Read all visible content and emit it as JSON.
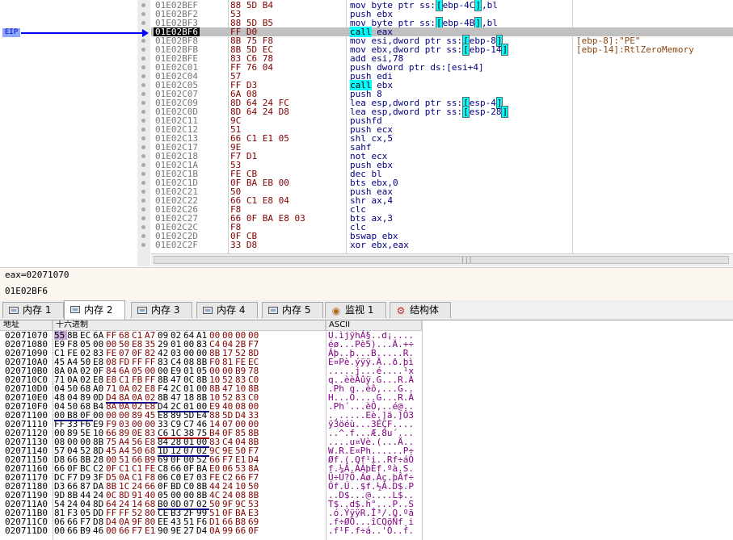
{
  "disassembly": {
    "eip_label": "EIP",
    "rows": [
      {
        "addr": "01E02BEF",
        "hex": "88 5D B4",
        "asm": [
          [
            "mov byte ptr ss:",
            ""
          ],
          [
            "[",
            "b"
          ],
          [
            "ebp-4C",
            ""
          ],
          [
            "]",
            "b"
          ],
          [
            ",bl",
            ""
          ]
        ],
        "cmt": ""
      },
      {
        "addr": "01E02BF2",
        "hex": "53",
        "asm": [
          [
            "push ebx",
            ""
          ]
        ],
        "cmt": ""
      },
      {
        "addr": "01E02BF3",
        "hex": "88 5D B5",
        "asm": [
          [
            "mov byte ptr ss:",
            ""
          ],
          [
            "[",
            "b"
          ],
          [
            "ebp-4B",
            ""
          ],
          [
            "]",
            "b"
          ],
          [
            ",bl",
            ""
          ]
        ],
        "cmt": ""
      },
      {
        "addr": "01E02BF6",
        "hex": "FF D0",
        "asm": [
          [
            "call",
            "h"
          ],
          [
            " eax",
            ""
          ]
        ],
        "cmt": "",
        "current": true
      },
      {
        "addr": "01E02BF8",
        "hex": "8B 75 F8",
        "asm": [
          [
            "mov esi,dword ptr ss:",
            ""
          ],
          [
            "[",
            "b"
          ],
          [
            "ebp-8",
            ""
          ],
          [
            "]",
            "b"
          ]
        ],
        "cmt": "[ebp-8]:\"PE\""
      },
      {
        "addr": "01E02BFB",
        "hex": "8B 5D EC",
        "asm": [
          [
            "mov ebx,dword ptr ss:",
            ""
          ],
          [
            "[",
            "b"
          ],
          [
            "ebp-14",
            ""
          ],
          [
            "]",
            "b"
          ]
        ],
        "cmt": "[ebp-14]:RtlZeroMemory"
      },
      {
        "addr": "01E02BFE",
        "hex": "83 C6 78",
        "asm": [
          [
            "add esi,78",
            ""
          ]
        ],
        "cmt": ""
      },
      {
        "addr": "01E02C01",
        "hex": "FF 76 04",
        "asm": [
          [
            "push dword ptr ds:[esi+4]",
            ""
          ]
        ],
        "cmt": ""
      },
      {
        "addr": "01E02C04",
        "hex": "57",
        "asm": [
          [
            "push edi",
            ""
          ]
        ],
        "cmt": ""
      },
      {
        "addr": "01E02C05",
        "hex": "FF D3",
        "asm": [
          [
            "call",
            "h"
          ],
          [
            " ebx",
            ""
          ]
        ],
        "cmt": ""
      },
      {
        "addr": "01E02C07",
        "hex": "6A 08",
        "asm": [
          [
            "push 8",
            ""
          ]
        ],
        "cmt": ""
      },
      {
        "addr": "01E02C09",
        "hex": "8D 64 24 FC",
        "asm": [
          [
            "lea esp,dword ptr ss:",
            ""
          ],
          [
            "[",
            "b"
          ],
          [
            "esp-4",
            ""
          ],
          [
            "]",
            "b"
          ]
        ],
        "cmt": ""
      },
      {
        "addr": "01E02C0D",
        "hex": "8D 64 24 D8",
        "asm": [
          [
            "lea esp,dword ptr ss:",
            ""
          ],
          [
            "[",
            "b"
          ],
          [
            "esp-28",
            ""
          ],
          [
            "]",
            "b"
          ]
        ],
        "cmt": ""
      },
      {
        "addr": "01E02C11",
        "hex": "9C",
        "asm": [
          [
            "pushfd",
            ""
          ]
        ],
        "cmt": ""
      },
      {
        "addr": "01E02C12",
        "hex": "51",
        "asm": [
          [
            "push ecx",
            ""
          ]
        ],
        "cmt": ""
      },
      {
        "addr": "01E02C13",
        "hex": "66 C1 E1 05",
        "asm": [
          [
            "shl cx,5",
            ""
          ]
        ],
        "cmt": ""
      },
      {
        "addr": "01E02C17",
        "hex": "9E",
        "asm": [
          [
            "sahf",
            ""
          ]
        ],
        "cmt": ""
      },
      {
        "addr": "01E02C18",
        "hex": "F7 D1",
        "asm": [
          [
            "not ecx",
            ""
          ]
        ],
        "cmt": ""
      },
      {
        "addr": "01E02C1A",
        "hex": "53",
        "asm": [
          [
            "push ebx",
            ""
          ]
        ],
        "cmt": ""
      },
      {
        "addr": "01E02C1B",
        "hex": "FE CB",
        "asm": [
          [
            "dec bl",
            ""
          ]
        ],
        "cmt": ""
      },
      {
        "addr": "01E02C1D",
        "hex": "0F BA EB 00",
        "asm": [
          [
            "bts ebx,0",
            ""
          ]
        ],
        "cmt": ""
      },
      {
        "addr": "01E02C21",
        "hex": "50",
        "asm": [
          [
            "push eax",
            ""
          ]
        ],
        "cmt": ""
      },
      {
        "addr": "01E02C22",
        "hex": "66 C1 E8 04",
        "asm": [
          [
            "shr ax,4",
            ""
          ]
        ],
        "cmt": ""
      },
      {
        "addr": "01E02C26",
        "hex": "F8",
        "asm": [
          [
            "clc",
            ""
          ]
        ],
        "cmt": ""
      },
      {
        "addr": "01E02C27",
        "hex": "66 0F BA E8 03",
        "asm": [
          [
            "bts ax,3",
            ""
          ]
        ],
        "cmt": ""
      },
      {
        "addr": "01E02C2C",
        "hex": "F8",
        "asm": [
          [
            "clc",
            ""
          ]
        ],
        "cmt": ""
      },
      {
        "addr": "01E02C2D",
        "hex": "0F CB",
        "asm": [
          [
            "bswap ebx",
            ""
          ]
        ],
        "cmt": ""
      },
      {
        "addr": "01E02C2F",
        "hex": "33 D8",
        "asm": [
          [
            "xor ebx,eax",
            ""
          ]
        ],
        "cmt": ""
      }
    ]
  },
  "info": {
    "register": "eax=02071070",
    "address": "01E02BF6"
  },
  "tabs": [
    {
      "label": "内存 1",
      "icon": "memory-icon",
      "active": false
    },
    {
      "label": "内存 2",
      "icon": "memory-icon",
      "active": true
    },
    {
      "label": "内存 3",
      "icon": "memory-icon",
      "active": false
    },
    {
      "label": "内存 4",
      "icon": "memory-icon",
      "active": false
    },
    {
      "label": "内存 5",
      "icon": "memory-icon",
      "active": false
    },
    {
      "label": "监视 1",
      "icon": "watch-icon",
      "active": false
    },
    {
      "label": "结构体",
      "icon": "struct-icon",
      "active": false
    }
  ],
  "dump": {
    "headers": {
      "address": "地址",
      "hex": "十六进制",
      "ascii": "ASCII"
    },
    "rows": [
      {
        "addr": "02071070",
        "bytes": "55 8B EC 6A FF 68 C1 A7 09 02 64 A1 00 00 00 00",
        "ascii": "U.ìjÿhÁ§..d¡...."
      },
      {
        "addr": "02071080",
        "bytes": "E9 F8 05 00 00 50 E8 35 29 01 00 83 C4 04 2B F7",
        "ascii": "éø...Pè5)...Ä.+÷"
      },
      {
        "addr": "02071090",
        "bytes": "C1 FE 02 83 FE 07 0F 82 42 03 00 00 8B 17 52 8D",
        "ascii": "Áþ..þ...B.....R."
      },
      {
        "addr": "020710A0",
        "bytes": "45 A4 50 E8 08 FD FF FF 83 C4 08 8B F0 81 FE EC",
        "ascii": "E¤Pè.ýÿÿ.Ä..ð.þì"
      },
      {
        "addr": "020710B0",
        "bytes": "8A 0A 02 0F 84 6A 05 00 00 E9 01 05 00 00 B9 78",
        "ascii": ".....j...é....¹x"
      },
      {
        "addr": "020710C0",
        "bytes": "71 0A 02 E8 E8 C1 FB FF 8B 47 0C 8B 10 52 83 C0",
        "ascii": "q..èèÁûÿ.G...R.À"
      },
      {
        "addr": "020710D0",
        "bytes": "04 50 68 A0 71 0A 02 E8 F4 2C 01 00 8B 47 10 8B",
        "ascii": ".Ph q..èô,...G.."
      },
      {
        "addr": "020710E0",
        "bytes": "48 04 89 0D D4 8A 0A 02 8B 47 18 8B 10 52 83 C0",
        "ascii": "H...Ô....G...R.À"
      },
      {
        "addr": "020710F0",
        "bytes": "04 50 68 B4 8A 0A 02 E8 D4 2C 01 00 E9 40 08 00",
        "ascii": ".Ph´...èÔ,..é@.."
      },
      {
        "addr": "02071100",
        "bytes": "00 B8 0F 00 00 00 89 45 E8 89 5D E4 88 5D D4 33",
        "ascii": ".¸.....Eè.]ä.]Ô3"
      },
      {
        "addr": "02071110",
        "bytes": "FF 33 F6 E9 F9 03 00 00 33 C9 C7 46 14 07 00 00",
        "ascii": "ÿ3öéù...3ÉÇF...."
      },
      {
        "addr": "02071120",
        "bytes": "00 89 5E 10 66 89 0E 83 C6 1C 38 75 B4 0F 85 8B",
        "ascii": "..^.f...Æ.8u´..."
      },
      {
        "addr": "02071130",
        "bytes": "08 00 00 8B 75 A4 56 E8 84 28 01 00 83 C4 04 8B",
        "ascii": "....u¤Vè.(...Ä.."
      },
      {
        "addr": "02071140",
        "bytes": "57 04 52 8D 45 A4 50 68 1D 12 07 02 9C 9E 50 F7",
        "ascii": "W.R.E¤Ph......P÷"
      },
      {
        "addr": "02071150",
        "bytes": "D8 66 8B 28 00 51 66 B9 69 0F 00 52 66 F7 E1 D4",
        "ascii": "Øf.(.Qf¹i..Rf÷áÔ"
      },
      {
        "addr": "02071160",
        "bytes": "66 0F BC C2 0F C1 C1 FE C8 66 0F BA E0 06 53 8A",
        "ascii": "f.¼Â.ÁÁþÈf.ºà.S."
      },
      {
        "addr": "02071170",
        "bytes": "DC F7 D9 3F D5 0A C1 F8 06 C0 E7 03 FE C2 66 F7",
        "ascii": "Ü÷Ù?Õ.Áø.Àç.þÂf÷"
      },
      {
        "addr": "02071180",
        "bytes": "D3 66 87 DA 8B 1C 24 66 0F BD C0 8B 44 24 10 50",
        "ascii": "Óf.Ú..$f.½À.D$.P"
      },
      {
        "addr": "02071190",
        "bytes": "9D 8B 44 24 0C 8D 91 40 05 00 00 8B 4C 24 08 8B",
        "ascii": "..D$...@....L$.."
      },
      {
        "addr": "020711A0",
        "bytes": "54 24 04 8D 64 24 14 68 B0 0D 07 02 50 9F 9C 53",
        "ascii": "T$..d$.h°...P..S"
      },
      {
        "addr": "020711B0",
        "bytes": "81 F3 05 DD FF FF 52 80 CE B3 2F 99 51 0F BA E3",
        "ascii": ".ó.ÝÿÿR.Î³/.Q.ºã"
      },
      {
        "addr": "020711C0",
        "bytes": "06 66 F7 D8 D4 0A 9F 80 EE 43 51 F6 D1 66 B8 69",
        "ascii": ".f÷ØÔ...îCQöÑf¸i"
      },
      {
        "addr": "020711D0",
        "bytes": "00 66 B9 46 00 66 F7 E1 90 9E 27 D4 0A 99 66 0F",
        "ascii": ".f¹F.f÷á..'Ô..f."
      }
    ]
  },
  "colors": {
    "eip": "#0000ff",
    "call_highlight": "#00ffff",
    "current_row": "#c0c0c0",
    "selected_byte": "#c8a8d8"
  }
}
